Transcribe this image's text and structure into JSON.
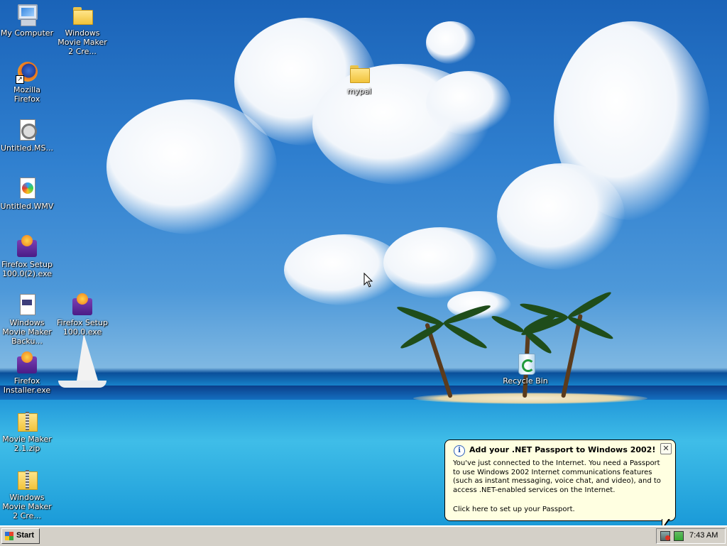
{
  "desktop": {
    "icons": [
      {
        "label": "My Computer",
        "icon": "my-computer-icon"
      },
      {
        "label": "Windows Movie Maker 2 Cre...",
        "icon": "folder-icon"
      },
      {
        "label": "Mozilla Firefox",
        "icon": "firefox-icon"
      },
      {
        "label": "mypal",
        "icon": "folder-icon"
      },
      {
        "label": "Untitled.MS...",
        "icon": "media-project-icon"
      },
      {
        "label": "Untitled.WMV",
        "icon": "wmv-file-icon"
      },
      {
        "label": "Firefox Setup 100.0(2).exe",
        "icon": "installer-icon"
      },
      {
        "label": "Windows Movie Maker Backu...",
        "icon": "text-document-icon"
      },
      {
        "label": "Firefox Setup 100.0.exe",
        "icon": "installer-icon"
      },
      {
        "label": "Recycle Bin",
        "icon": "recycle-bin-icon"
      },
      {
        "label": "Firefox Installer.exe",
        "icon": "installer-icon"
      },
      {
        "label": "Movie Maker 2.1.zip",
        "icon": "zip-folder-icon"
      },
      {
        "label": "Windows Movie Maker 2 Cre...",
        "icon": "zip-folder-icon"
      }
    ]
  },
  "balloon": {
    "title": "Add your .NET Passport to Windows 2002!",
    "body": "You've just connected to the Internet.  You need a Passport to use Windows 2002 Internet communications features (such as instant messaging, voice chat, and video), and to access .NET-enabled services on the Internet.",
    "link": "Click here to set up your Passport.",
    "close_glyph": "✕",
    "info_glyph": "i"
  },
  "taskbar": {
    "start_label": "Start",
    "clock": "7:43 AM"
  }
}
